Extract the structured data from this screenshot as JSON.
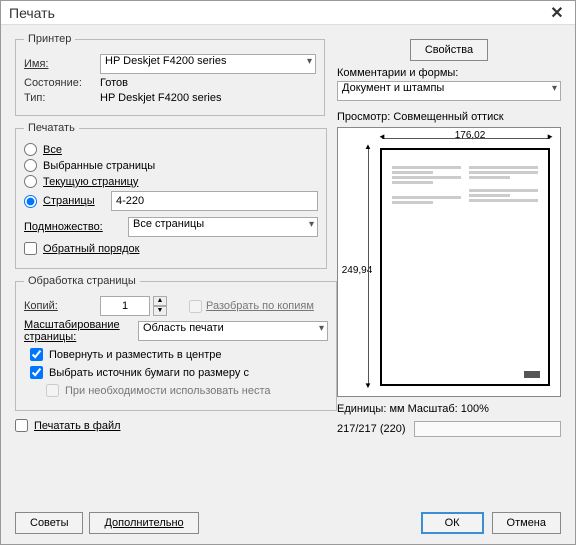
{
  "title": "Печать",
  "printer": {
    "legend": "Принтер",
    "name_label": "Имя:",
    "name_value": "HP Deskjet F4200 series",
    "properties_btn": "Свойства",
    "status_label": "Состояние:",
    "status_value": "Готов",
    "type_label": "Тип:",
    "type_value": "HP Deskjet F4200 series",
    "forms_label": "Комментарии и формы:",
    "forms_value": "Документ и штампы"
  },
  "range": {
    "legend": "Печатать",
    "all": "Все",
    "selected_pages": "Выбранные страницы",
    "current_page": "Текущую страницу",
    "pages": "Страницы",
    "pages_value": "4-220",
    "subset_label": "Подмножество:",
    "subset_value": "Все страницы",
    "reverse": "Обратный порядок"
  },
  "handling": {
    "legend": "Обработка страницы",
    "copies_label": "Копий:",
    "copies_value": "1",
    "collate": "Разобрать по копиям",
    "scaling_label": "Масштабирование страницы:",
    "scaling_value": "Область печати",
    "rotate": "Повернуть и разместить в центре",
    "source": "Выбрать источник бумаги по размеру с",
    "nonstd": "При необходимости использовать неста"
  },
  "print_to_file": "Печатать в файл",
  "preview": {
    "title": "Просмотр: Совмещенный оттиск",
    "width": "176,02",
    "height": "249,94",
    "units": "Единицы: мм Масштаб: 100%",
    "page_status": "217/217 (220)"
  },
  "buttons": {
    "tips": "Советы",
    "advanced": "Дополнительно",
    "ok": "ОК",
    "cancel": "Отмена"
  }
}
